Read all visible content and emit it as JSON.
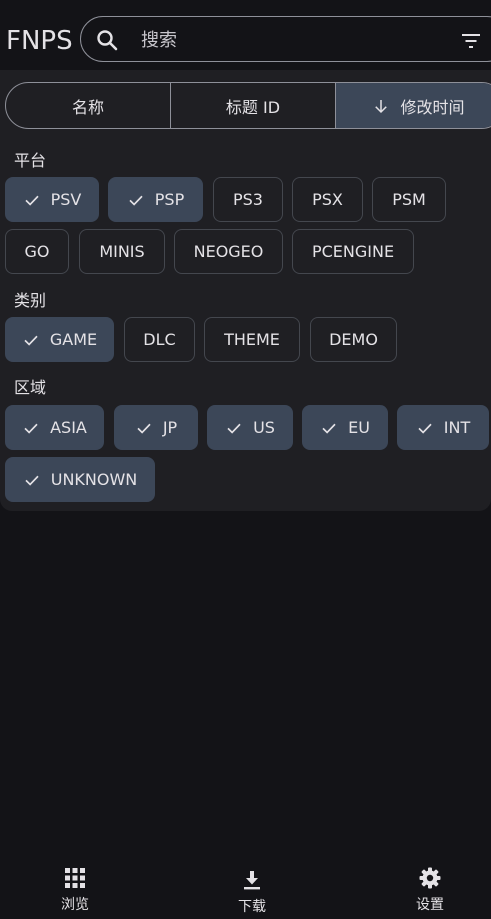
{
  "app": {
    "title": "FNPS"
  },
  "search": {
    "placeholder": "搜索",
    "value": ""
  },
  "sort": {
    "options": [
      {
        "label": "名称",
        "active": false
      },
      {
        "label": "标题 ID",
        "active": false
      },
      {
        "label": "修改时间",
        "active": true,
        "direction": "down"
      }
    ]
  },
  "filters": {
    "platform": {
      "label": "平台",
      "chips": [
        {
          "label": "PSV",
          "selected": true
        },
        {
          "label": "PSP",
          "selected": true
        },
        {
          "label": "PS3",
          "selected": false
        },
        {
          "label": "PSX",
          "selected": false
        },
        {
          "label": "PSM",
          "selected": false
        },
        {
          "label": "GO",
          "selected": false
        },
        {
          "label": "MINIS",
          "selected": false
        },
        {
          "label": "NEOGEO",
          "selected": false
        },
        {
          "label": "PCENGINE",
          "selected": false
        }
      ]
    },
    "category": {
      "label": "类别",
      "chips": [
        {
          "label": "GAME",
          "selected": true
        },
        {
          "label": "DLC",
          "selected": false
        },
        {
          "label": "THEME",
          "selected": false
        },
        {
          "label": "DEMO",
          "selected": false
        }
      ]
    },
    "region": {
      "label": "区域",
      "chips": [
        {
          "label": "ASIA",
          "selected": true
        },
        {
          "label": "JP",
          "selected": true
        },
        {
          "label": "US",
          "selected": true
        },
        {
          "label": "EU",
          "selected": true
        },
        {
          "label": "INT",
          "selected": true
        },
        {
          "label": "UNKNOWN",
          "selected": true
        }
      ]
    }
  },
  "nav": {
    "items": [
      {
        "label": "浏览",
        "icon": "grid-icon"
      },
      {
        "label": "下载",
        "icon": "download-icon"
      },
      {
        "label": "设置",
        "icon": "gear-icon"
      }
    ]
  },
  "colors": {
    "background": "#131317",
    "panel": "#1f1f23",
    "selected_chip": "#3c4758",
    "outline": "#8e9099",
    "text": "#e4e2e6"
  }
}
